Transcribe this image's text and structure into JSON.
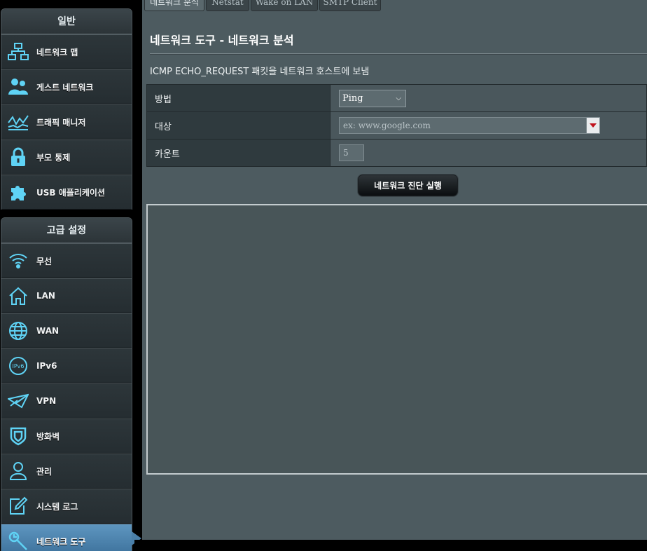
{
  "sidebar": {
    "general_header": "일반",
    "general_items": [
      {
        "label": "네트워크 맵",
        "icon": "network-map-icon"
      },
      {
        "label": "게스트 네트워크",
        "icon": "guest-network-icon"
      },
      {
        "label": "트래픽 매니저",
        "icon": "traffic-manager-icon"
      },
      {
        "label": "부모 통제",
        "icon": "lock-icon"
      },
      {
        "label": "USB 애플리케이션",
        "icon": "puzzle-icon"
      }
    ],
    "advanced_header": "고급 설정",
    "advanced_items": [
      {
        "label": "무선",
        "icon": "wifi-icon"
      },
      {
        "label": "LAN",
        "icon": "home-icon"
      },
      {
        "label": "WAN",
        "icon": "globe-icon"
      },
      {
        "label": "IPv6",
        "icon": "ipv6-icon"
      },
      {
        "label": "VPN",
        "icon": "vpn-icon"
      },
      {
        "label": "방화벽",
        "icon": "shield-icon"
      },
      {
        "label": "관리",
        "icon": "admin-user-icon"
      },
      {
        "label": "시스템 로그",
        "icon": "edit-log-icon"
      },
      {
        "label": "네트워크 도구",
        "icon": "wrench-icon",
        "active": true
      }
    ]
  },
  "tabs": [
    {
      "label": "네트워크 분석",
      "active": true
    },
    {
      "label": "Netstat"
    },
    {
      "label": "Wake on LAN"
    },
    {
      "label": "SMTP Client"
    }
  ],
  "page": {
    "title": "네트워크 도구 - 네트워크 분석",
    "description": "ICMP ECHO_REQUEST 패킷을 네트워크 호스트에 보냄"
  },
  "form": {
    "method_label": "방법",
    "method_value": "Ping",
    "target_label": "대상",
    "target_placeholder": "ex: www.google.com",
    "count_label": "카운트",
    "count_value": "5"
  },
  "run_button": "네트워크 진단 실행",
  "colors": {
    "icon_accent": "#5fd3f5",
    "active_menu": "#4a7fa8",
    "dropdown_arrow": "#c0121c"
  }
}
